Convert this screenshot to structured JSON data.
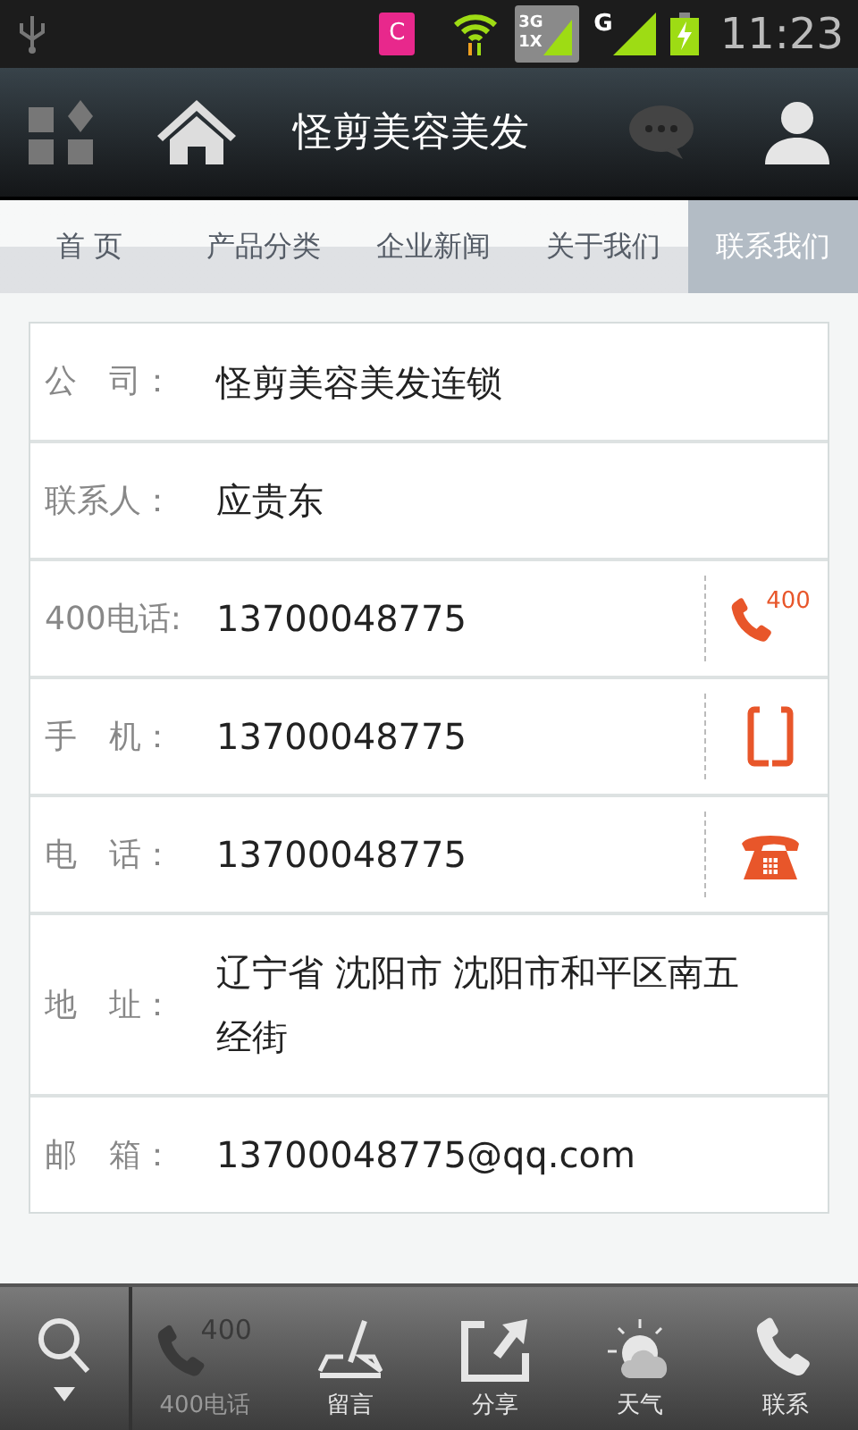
{
  "status_bar": {
    "app_badge": "C",
    "network_top": "3G",
    "network_bottom": "1X",
    "signal_label": "G",
    "time": "11:23"
  },
  "header": {
    "title": "怪剪美容美发"
  },
  "tabs": [
    {
      "label": "首 页",
      "selected": false
    },
    {
      "label": "产品分类",
      "selected": false
    },
    {
      "label": "企业新闻",
      "selected": false
    },
    {
      "label": "关于我们",
      "selected": false
    },
    {
      "label": "联系我们",
      "selected": true
    }
  ],
  "contacts": [
    {
      "label": "公　司：",
      "value": "怪剪美容美发连锁",
      "kind": "plain"
    },
    {
      "label": "联系人：",
      "value": "应贵东",
      "kind": "plain"
    },
    {
      "label": "400电话:",
      "value": "13700048775",
      "kind": "hotline",
      "badge": "400"
    },
    {
      "label": "手　机：",
      "value": "13700048775",
      "kind": "mobile"
    },
    {
      "label": "电　话：",
      "value": "13700048775",
      "kind": "landline"
    },
    {
      "label": "地　址：",
      "value": "辽宁省 沈阳市 沈阳市和平区南五经街",
      "kind": "plain"
    },
    {
      "label": "邮　箱：",
      "value": "13700048775@qq.com",
      "kind": "plain"
    }
  ],
  "bottom_bar": [
    {
      "kind": "search"
    },
    {
      "kind": "hotline",
      "label": "400电话",
      "badge": "400",
      "disabled": true
    },
    {
      "kind": "message",
      "label": "留言",
      "disabled": false
    },
    {
      "kind": "share",
      "label": "分享",
      "disabled": false
    },
    {
      "kind": "weather",
      "label": "天气",
      "disabled": false
    },
    {
      "kind": "contact",
      "label": "联系",
      "disabled": false
    }
  ]
}
